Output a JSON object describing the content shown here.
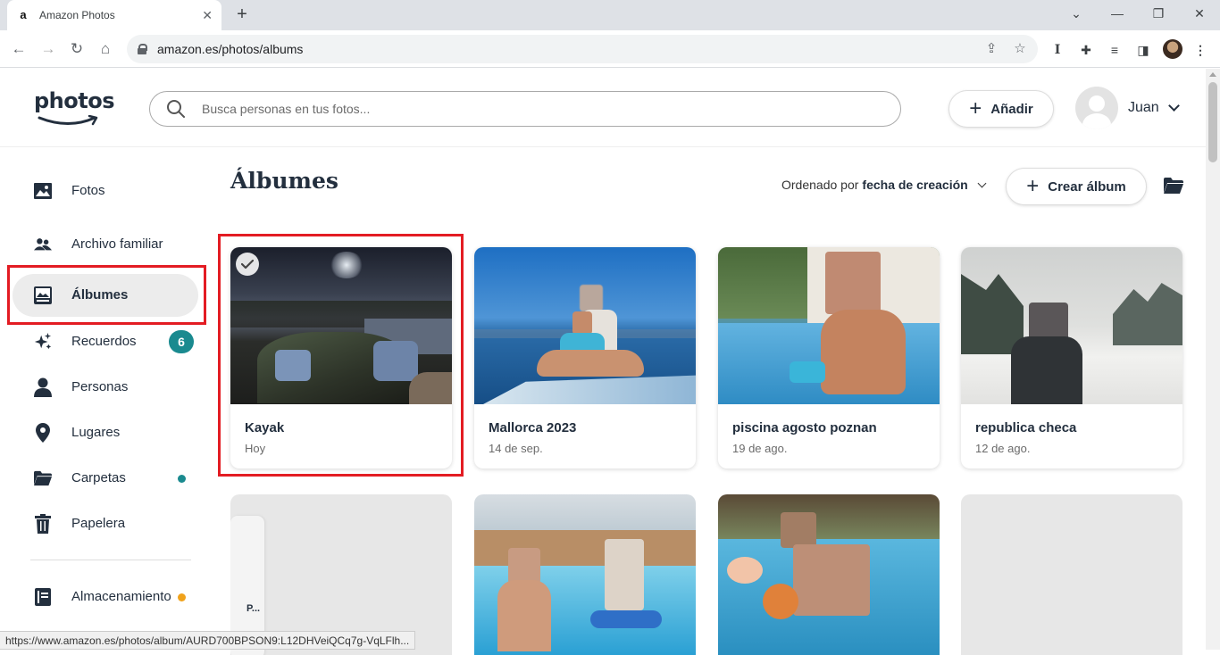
{
  "browser": {
    "tab_title": "Amazon Photos",
    "tab_favicon": "a",
    "url": "amazon.es/photos/albums",
    "status_url": "https://www.amazon.es/photos/album/AURD700BPSON9:L12DHVeiQCq7g-VqLFlh..."
  },
  "header": {
    "logo_text": "photos",
    "search_placeholder": "Busca personas en tus fotos...",
    "add_label": "Añadir",
    "user_name": "Juan"
  },
  "sidebar": {
    "items": [
      {
        "label": "Fotos",
        "icon": "photo-icon"
      },
      {
        "label": "Archivo familiar",
        "icon": "people-icon"
      },
      {
        "label": "Álbumes",
        "icon": "albums-icon"
      },
      {
        "label": "Recuerdos",
        "icon": "sparkles-icon",
        "badge": "6"
      },
      {
        "label": "Personas",
        "icon": "person-icon"
      },
      {
        "label": "Lugares",
        "icon": "location-pin-icon"
      },
      {
        "label": "Carpetas",
        "icon": "folder-icon"
      },
      {
        "label": "Papelera",
        "icon": "trash-icon"
      },
      {
        "label": "Almacenamiento",
        "icon": "storage-icon"
      }
    ]
  },
  "main": {
    "title": "Álbumes",
    "sort_prefix": "Ordenado por",
    "sort_value": "fecha de creación",
    "create_label": "Crear álbum",
    "partial_tile_label": "P...",
    "albums": [
      {
        "name": "Kayak",
        "date": "Hoy"
      },
      {
        "name": "Mallorca 2023",
        "date": "14 de sep."
      },
      {
        "name": "piscina agosto poznan",
        "date": "19 de ago."
      },
      {
        "name": "republica checa",
        "date": "12 de ago."
      }
    ]
  },
  "colors": {
    "badge_teal": "#1a8a8f",
    "dot_teal": "#1a8a8f",
    "dot_orange": "#f0a21b",
    "highlight_red": "#e31c23"
  }
}
